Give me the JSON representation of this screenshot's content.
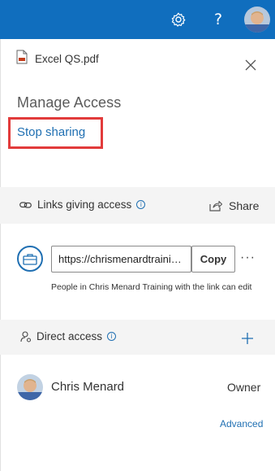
{
  "topbar": {
    "settings_icon": "gear-icon",
    "help_label": "?",
    "avatar": "user-avatar"
  },
  "file": {
    "icon": "pdf-file-icon",
    "name": "Excel QS.pdf"
  },
  "panel": {
    "title": "Manage Access",
    "stop_sharing": "Stop sharing",
    "close_icon": "close-icon"
  },
  "links_section": {
    "label": "Links giving access",
    "info_icon_text": "i",
    "share_label": "Share",
    "link_url": "https://chrismenardtraining.sharepoint.com/",
    "copy_label": "Copy",
    "more_label": "···",
    "description": "People in Chris Menard Training with the link can edit"
  },
  "direct_section": {
    "label": "Direct access",
    "info_icon_text": "i"
  },
  "people": [
    {
      "name": "Chris Menard",
      "role": "Owner"
    }
  ],
  "advanced_label": "Advanced",
  "colors": {
    "topbar": "#106ebe",
    "link": "#1f6fb2",
    "highlight_box": "#e23b3b",
    "band": "#f4f4f4"
  }
}
